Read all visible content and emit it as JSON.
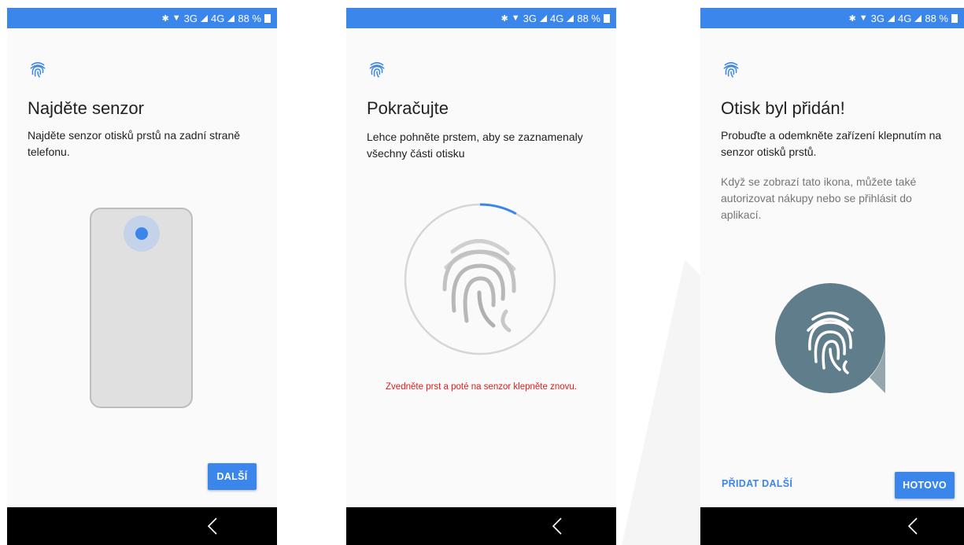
{
  "status_bar": {
    "bluetooth_icon": "bluetooth-icon",
    "wifi_icon": "wifi-icon",
    "network_3g": "3G",
    "network_4g": "4G",
    "battery": "88 %"
  },
  "colors": {
    "accent": "#3b86ea",
    "error": "#e21b1b",
    "status_bar": "#3b86ea",
    "nav_bar": "#000000",
    "fingerprint_circle": "#607d8b"
  },
  "screen1": {
    "title": "Najděte senzor",
    "description": "Najděte senzor otisků prstů na zadní straně telefonu.",
    "next_button": "DALŠÍ"
  },
  "screen2": {
    "title": "Pokračujte",
    "description": "Lehce pohněte prstem, aby se zaznamenaly všechny části otisku",
    "error_message": "Zvedněte prst a poté na senzor klepněte znovu.",
    "progress_fraction": 0.08
  },
  "screen3": {
    "title": "Otisk byl přidán!",
    "description": "Probuďte a odemkněte zařízení klepnutím na senzor otisků prstů.",
    "secondary_text": "Když se zobrazí tato ikona, můžete také autorizovat nákupy nebo se přihlásit do aplikací.",
    "add_more_button": "PŘIDAT DALŠÍ",
    "done_button": "HOTOVO"
  }
}
